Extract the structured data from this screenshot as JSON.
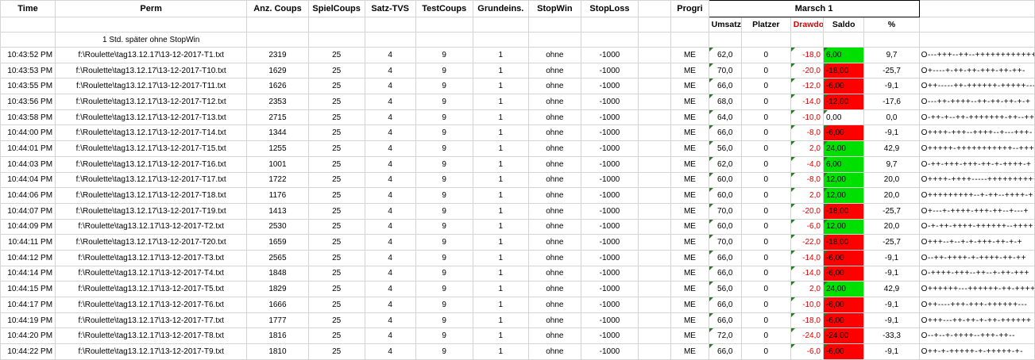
{
  "headers": {
    "time": "Time",
    "perm": "Perm",
    "anz_coups": "Anz. Coups",
    "spielcoups": "SpielCoups",
    "satz_tvs": "Satz-TVS",
    "testcoups": "TestCoups",
    "grundeins": "Grundeins.",
    "stopwin": "StopWin",
    "stoploss": "StopLoss",
    "progri": "Progri",
    "marsch": "Marsch 1",
    "umsatz": "Umsatz",
    "platzer": "Platzer",
    "drawdown": "Drawdown",
    "saldo": "Saldo",
    "percent": "%"
  },
  "note": "1 Std. später ohne StopWin",
  "colors": {
    "green": "#00e000",
    "red": "#ff0000",
    "drawdown_text": "#e00000"
  },
  "rows": [
    {
      "time": "10:43:52 PM",
      "perm": "f:\\Roulette\\tag13.12.17\\13-12-2017-T1.txt",
      "anz": "2319",
      "spiel": "25",
      "satz": "4",
      "test": "9",
      "grund": "1",
      "stopwin": "ohne",
      "stoploss": "-1000",
      "progri": "ME",
      "umsatz": "62,0",
      "platzer": "0",
      "drawdown": "-18,0",
      "saldo": "6,00",
      "saldo_color": "green",
      "percent": "9,7",
      "pattern": "O---+++--++--+++++++++++++"
    },
    {
      "time": "10:43:53 PM",
      "perm": "f:\\Roulette\\tag13.12.17\\13-12-2017-T10.txt",
      "anz": "1629",
      "spiel": "25",
      "satz": "4",
      "test": "9",
      "grund": "1",
      "stopwin": "ohne",
      "stoploss": "-1000",
      "progri": "ME",
      "umsatz": "70,0",
      "platzer": "0",
      "drawdown": "-20,0",
      "saldo": "-18,00",
      "saldo_color": "red",
      "percent": "-25,7",
      "pattern": "O+----+-++-++-+++-++-++-"
    },
    {
      "time": "10:43:55 PM",
      "perm": "f:\\Roulette\\tag13.12.17\\13-12-2017-T11.txt",
      "anz": "1626",
      "spiel": "25",
      "satz": "4",
      "test": "9",
      "grund": "1",
      "stopwin": "ohne",
      "stoploss": "-1000",
      "progri": "ME",
      "umsatz": "66,0",
      "platzer": "0",
      "drawdown": "-12,0",
      "saldo": "-6,00",
      "saldo_color": "red",
      "percent": "-9,1",
      "pattern": "O++-----++-++++++-+++++---"
    },
    {
      "time": "10:43:56 PM",
      "perm": "f:\\Roulette\\tag13.12.17\\13-12-2017-T12.txt",
      "anz": "2353",
      "spiel": "25",
      "satz": "4",
      "test": "9",
      "grund": "1",
      "stopwin": "ohne",
      "stoploss": "-1000",
      "progri": "ME",
      "umsatz": "68,0",
      "platzer": "0",
      "drawdown": "-14,0",
      "saldo": "-12,00",
      "saldo_color": "red",
      "percent": "-17,6",
      "pattern": "O---++-++++--++-++-++-+-+"
    },
    {
      "time": "10:43:58 PM",
      "perm": "f:\\Roulette\\tag13.12.17\\13-12-2017-T13.txt",
      "anz": "2715",
      "spiel": "25",
      "satz": "4",
      "test": "9",
      "grund": "1",
      "stopwin": "ohne",
      "stoploss": "-1000",
      "progri": "ME",
      "umsatz": "64,0",
      "platzer": "0",
      "drawdown": "-10,0",
      "saldo": "0,00",
      "saldo_color": "none",
      "percent": "0,0",
      "pattern": "O-++-+--++-+++++++-++--++"
    },
    {
      "time": "10:44:00 PM",
      "perm": "f:\\Roulette\\tag13.12.17\\13-12-2017-T14.txt",
      "anz": "1344",
      "spiel": "25",
      "satz": "4",
      "test": "9",
      "grund": "1",
      "stopwin": "ohne",
      "stoploss": "-1000",
      "progri": "ME",
      "umsatz": "66,0",
      "platzer": "0",
      "drawdown": "-8,0",
      "saldo": "-6,00",
      "saldo_color": "red",
      "percent": "-9,1",
      "pattern": "O++++-+++--++++--+---+++-"
    },
    {
      "time": "10:44:01 PM",
      "perm": "f:\\Roulette\\tag13.12.17\\13-12-2017-T15.txt",
      "anz": "1255",
      "spiel": "25",
      "satz": "4",
      "test": "9",
      "grund": "1",
      "stopwin": "ohne",
      "stoploss": "-1000",
      "progri": "ME",
      "umsatz": "56,0",
      "platzer": "0",
      "drawdown": "2,0",
      "saldo": "24,00",
      "saldo_color": "green",
      "percent": "42,9",
      "pattern": "O+++++-+++++++++++--+++-+"
    },
    {
      "time": "10:44:03 PM",
      "perm": "f:\\Roulette\\tag13.12.17\\13-12-2017-T16.txt",
      "anz": "1001",
      "spiel": "25",
      "satz": "4",
      "test": "9",
      "grund": "1",
      "stopwin": "ohne",
      "stoploss": "-1000",
      "progri": "ME",
      "umsatz": "62,0",
      "platzer": "0",
      "drawdown": "-4,0",
      "saldo": "6,00",
      "saldo_color": "green",
      "percent": "9,7",
      "pattern": "O-++-+++-+++-++-+-++++-+"
    },
    {
      "time": "10:44:04 PM",
      "perm": "f:\\Roulette\\tag13.12.17\\13-12-2017-T17.txt",
      "anz": "1722",
      "spiel": "25",
      "satz": "4",
      "test": "9",
      "grund": "1",
      "stopwin": "ohne",
      "stoploss": "-1000",
      "progri": "ME",
      "umsatz": "60,0",
      "platzer": "0",
      "drawdown": "-8,0",
      "saldo": "12,00",
      "saldo_color": "green",
      "percent": "20,0",
      "pattern": "O++++-++++-----++++++++++"
    },
    {
      "time": "10:44:06 PM",
      "perm": "f:\\Roulette\\tag13.12.17\\13-12-2017-T18.txt",
      "anz": "1176",
      "spiel": "25",
      "satz": "4",
      "test": "9",
      "grund": "1",
      "stopwin": "ohne",
      "stoploss": "-1000",
      "progri": "ME",
      "umsatz": "60,0",
      "platzer": "0",
      "drawdown": "2,0",
      "saldo": "12,00",
      "saldo_color": "green",
      "percent": "20,0",
      "pattern": "O+++++++++--+-++--++++-+"
    },
    {
      "time": "10:44:07 PM",
      "perm": "f:\\Roulette\\tag13.12.17\\13-12-2017-T19.txt",
      "anz": "1413",
      "spiel": "25",
      "satz": "4",
      "test": "9",
      "grund": "1",
      "stopwin": "ohne",
      "stoploss": "-1000",
      "progri": "ME",
      "umsatz": "70,0",
      "platzer": "0",
      "drawdown": "-20,0",
      "saldo": "-18,00",
      "saldo_color": "red",
      "percent": "-25,7",
      "pattern": "O+---+-++++-+++-++--+---+"
    },
    {
      "time": "10:44:09 PM",
      "perm": "f:\\Roulette\\tag13.12.17\\13-12-2017-T2.txt",
      "anz": "2530",
      "spiel": "25",
      "satz": "4",
      "test": "9",
      "grund": "1",
      "stopwin": "ohne",
      "stoploss": "-1000",
      "progri": "ME",
      "umsatz": "60,0",
      "platzer": "0",
      "drawdown": "-6,0",
      "saldo": "12,00",
      "saldo_color": "green",
      "percent": "20,0",
      "pattern": "O-+-++-++++-++++++--++++"
    },
    {
      "time": "10:44:11 PM",
      "perm": "f:\\Roulette\\tag13.12.17\\13-12-2017-T20.txt",
      "anz": "1659",
      "spiel": "25",
      "satz": "4",
      "test": "9",
      "grund": "1",
      "stopwin": "ohne",
      "stoploss": "-1000",
      "progri": "ME",
      "umsatz": "70,0",
      "platzer": "0",
      "drawdown": "-22,0",
      "saldo": "-18,00",
      "saldo_color": "red",
      "percent": "-25,7",
      "pattern": "O+++--+--+-+-+++-++-+-+"
    },
    {
      "time": "10:44:12 PM",
      "perm": "f:\\Roulette\\tag13.12.17\\13-12-2017-T3.txt",
      "anz": "2565",
      "spiel": "25",
      "satz": "4",
      "test": "9",
      "grund": "1",
      "stopwin": "ohne",
      "stoploss": "-1000",
      "progri": "ME",
      "umsatz": "66,0",
      "platzer": "0",
      "drawdown": "-14,0",
      "saldo": "-6,00",
      "saldo_color": "red",
      "percent": "-9,1",
      "pattern": "O--++-++++-+-++++-++-++"
    },
    {
      "time": "10:44:14 PM",
      "perm": "f:\\Roulette\\tag13.12.17\\13-12-2017-T4.txt",
      "anz": "1848",
      "spiel": "25",
      "satz": "4",
      "test": "9",
      "grund": "1",
      "stopwin": "ohne",
      "stoploss": "-1000",
      "progri": "ME",
      "umsatz": "66,0",
      "platzer": "0",
      "drawdown": "-14,0",
      "saldo": "-6,00",
      "saldo_color": "red",
      "percent": "-9,1",
      "pattern": "O-++++-+++--++--+-++-+++"
    },
    {
      "time": "10:44:15 PM",
      "perm": "f:\\Roulette\\tag13.12.17\\13-12-2017-T5.txt",
      "anz": "1829",
      "spiel": "25",
      "satz": "4",
      "test": "9",
      "grund": "1",
      "stopwin": "ohne",
      "stoploss": "-1000",
      "progri": "ME",
      "umsatz": "56,0",
      "platzer": "0",
      "drawdown": "2,0",
      "saldo": "24,00",
      "saldo_color": "green",
      "percent": "42,9",
      "pattern": "O++++++---++++++-++-++++++"
    },
    {
      "time": "10:44:17 PM",
      "perm": "f:\\Roulette\\tag13.12.17\\13-12-2017-T6.txt",
      "anz": "1666",
      "spiel": "25",
      "satz": "4",
      "test": "9",
      "grund": "1",
      "stopwin": "ohne",
      "stoploss": "-1000",
      "progri": "ME",
      "umsatz": "66,0",
      "platzer": "0",
      "drawdown": "-10,0",
      "saldo": "-6,00",
      "saldo_color": "red",
      "percent": "-9,1",
      "pattern": "O++----+++-+++-++++++---"
    },
    {
      "time": "10:44:19 PM",
      "perm": "f:\\Roulette\\tag13.12.17\\13-12-2017-T7.txt",
      "anz": "1777",
      "spiel": "25",
      "satz": "4",
      "test": "9",
      "grund": "1",
      "stopwin": "ohne",
      "stoploss": "-1000",
      "progri": "ME",
      "umsatz": "66,0",
      "platzer": "0",
      "drawdown": "-18,0",
      "saldo": "-6,00",
      "saldo_color": "red",
      "percent": "-9,1",
      "pattern": "O+++---++-++-+-++-++++++"
    },
    {
      "time": "10:44:20 PM",
      "perm": "f:\\Roulette\\tag13.12.17\\13-12-2017-T8.txt",
      "anz": "1816",
      "spiel": "25",
      "satz": "4",
      "test": "9",
      "grund": "1",
      "stopwin": "ohne",
      "stoploss": "-1000",
      "progri": "ME",
      "umsatz": "72,0",
      "platzer": "0",
      "drawdown": "-24,0",
      "saldo": "-24,00",
      "saldo_color": "red",
      "percent": "-33,3",
      "pattern": "O--+--+-++++--+++-++--"
    },
    {
      "time": "10:44:22 PM",
      "perm": "f:\\Roulette\\tag13.12.17\\13-12-2017-T9.txt",
      "anz": "1810",
      "spiel": "25",
      "satz": "4",
      "test": "9",
      "grund": "1",
      "stopwin": "ohne",
      "stoploss": "-1000",
      "progri": "ME",
      "umsatz": "66,0",
      "platzer": "0",
      "drawdown": "-6,0",
      "saldo": "-6,00",
      "saldo_color": "red",
      "percent": "-9,1",
      "pattern": "O++-+-+++++-+-+++++-+-"
    }
  ]
}
